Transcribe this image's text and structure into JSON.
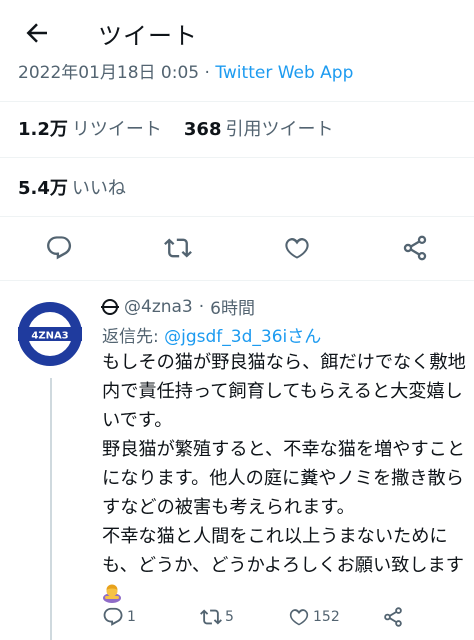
{
  "header": {
    "title": "ツイート",
    "back_icon": "arrow-left-icon"
  },
  "tweet_meta": {
    "timestamp": "2022年01月18日 0:05",
    "separator": " · ",
    "via": "Twitter Web App"
  },
  "stats": {
    "retweets_count": "1.2万",
    "retweets_label": "リツイート",
    "quotes_count": "368",
    "quotes_label": "引用ツイート",
    "likes_count": "5.4万",
    "likes_label": "いいね"
  },
  "actions": [
    "reply-icon",
    "retweet-icon",
    "like-icon",
    "share-icon"
  ],
  "reply": {
    "avatar_text": "4ZNA3",
    "handle": "@4zna3",
    "separator": "·",
    "time": "6時間",
    "reply_to_label": "返信先: ",
    "reply_to_mention": "@jgsdf_3d_36iさん",
    "body_lines": [
      "もしその猫が野良猫なら、餌だけでなく敷地内で責任持って飼育してもらえると大変嬉しいです。",
      "野良猫が繁殖すると、不幸な猫を増やすことになります。他人の庭に糞やノミを撒き散らすなどの被害も考えられます。",
      "不幸な猫と人間をこれ以上うまないためにも、どうか、どうかよろしくお願い致します"
    ],
    "emoji": "person-bowing-emoji",
    "reply_count": "1",
    "retweet_count": "5",
    "like_count": "152"
  },
  "colors": {
    "accent": "#1d9bf0",
    "secondary_text": "#536471",
    "avatar_blue": "#1f3b9e",
    "avatar_ring": "#e8362e"
  }
}
